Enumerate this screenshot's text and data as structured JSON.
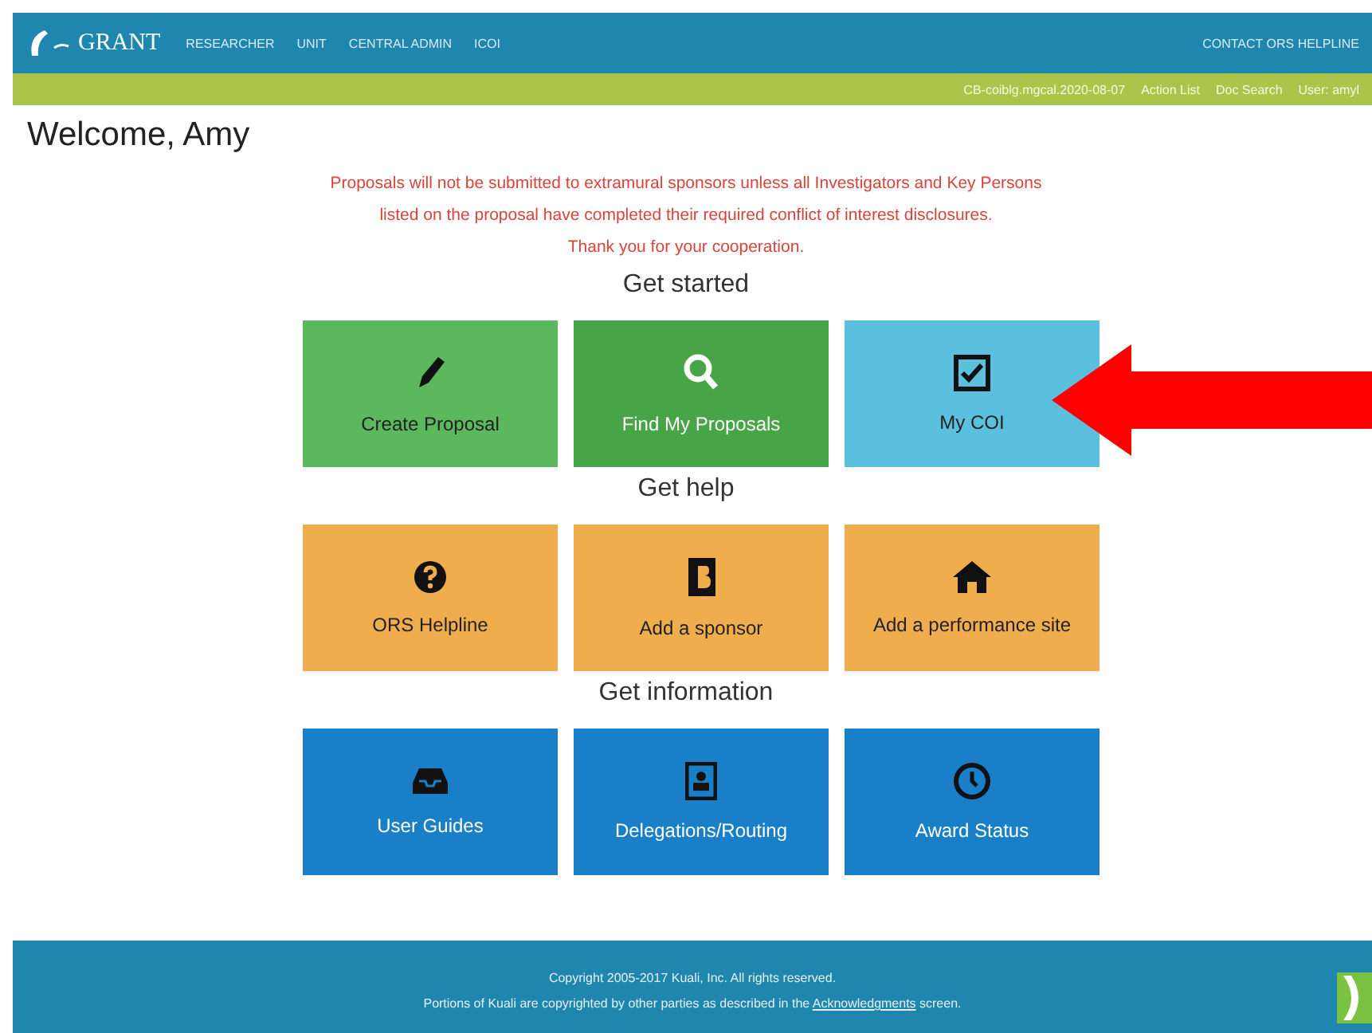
{
  "header": {
    "logo": "GRANT",
    "nav": [
      "RESEARCHER",
      "UNIT",
      "CENTRAL ADMIN",
      "ICOI"
    ],
    "contact": "CONTACT ORS HELPLINE"
  },
  "subbar": {
    "items": [
      "CB-coiblg.mgcal.2020-08-07",
      "Action List",
      "Doc Search",
      "User: amyl"
    ]
  },
  "welcome": "Welcome, Amy",
  "notice": [
    "Proposals will not be submitted to extramural sponsors unless all Investigators and Key Persons",
    "listed on the proposal have completed their required conflict of interest disclosures.",
    "Thank you for your cooperation."
  ],
  "sections": [
    {
      "heading": "Get started",
      "tiles": [
        {
          "label": "Create Proposal",
          "color": "#5cb85c"
        },
        {
          "label": "Find My Proposals",
          "color": "#47a447"
        },
        {
          "label": "My COI",
          "color": "#5bc0de"
        }
      ]
    },
    {
      "heading": "Get help",
      "tiles": [
        {
          "label": "ORS Helpline",
          "color": "#f0ad4e"
        },
        {
          "label": "Add a sponsor",
          "color": "#f0ad4e"
        },
        {
          "label": "Add a performance site",
          "color": "#f0ad4e"
        }
      ]
    },
    {
      "heading": "Get information",
      "tiles": [
        {
          "label": "User Guides",
          "color": "#1a7fc9"
        },
        {
          "label": "Delegations/Routing",
          "color": "#1a7fc9"
        },
        {
          "label": "Award Status",
          "color": "#1a7fc9"
        }
      ]
    }
  ],
  "footer": {
    "copyright": "Copyright 2005-2017 Kuali, Inc. All rights reserved.",
    "portions": "Portions of Kuali are copyrighted by other parties as described in the **Acknowledgments** screen."
  }
}
